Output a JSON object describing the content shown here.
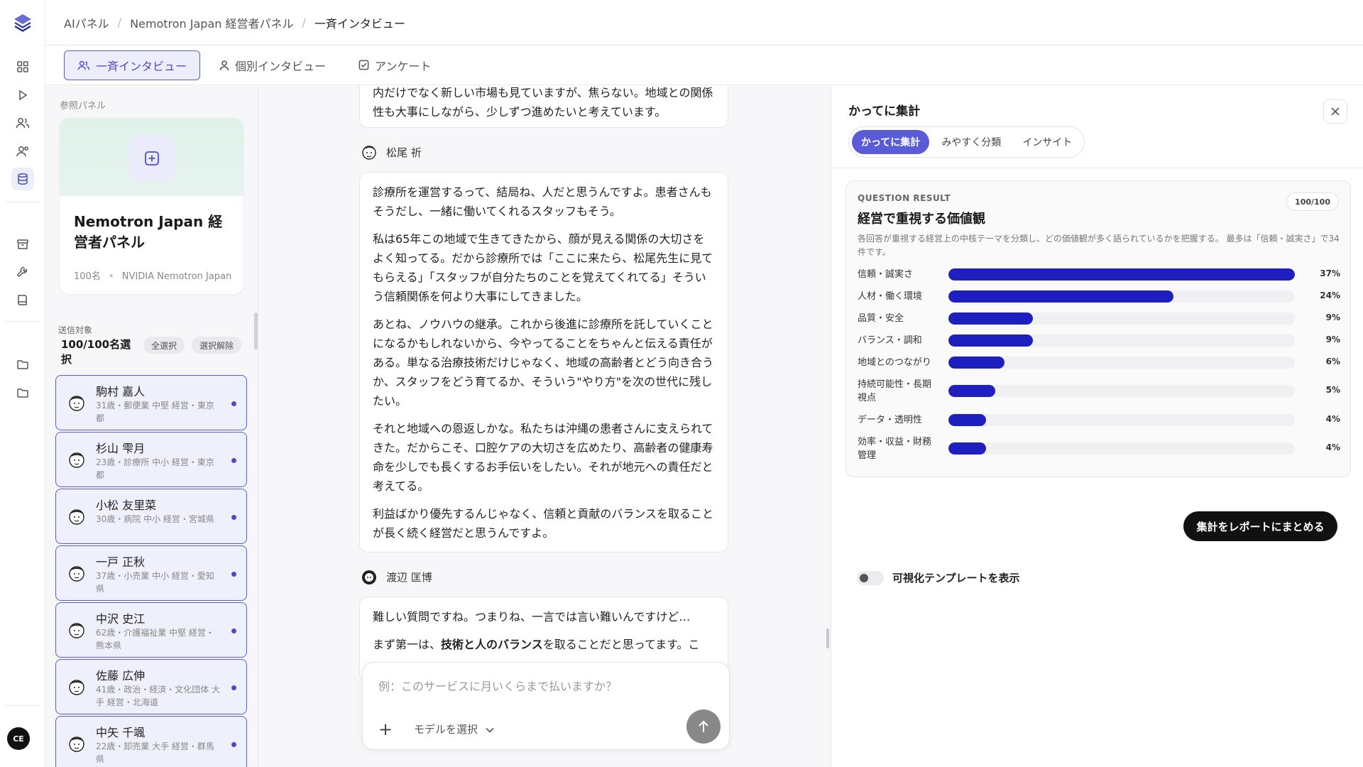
{
  "user": {
    "initials": "CE"
  },
  "breadcrumb": [
    "AIパネル",
    "Nemotron Japan 経営者パネル",
    "一斉インタビュー"
  ],
  "tabs": [
    {
      "label": "一斉インタビュー",
      "icon": "users-icon",
      "active": true
    },
    {
      "label": "個別インタビュー",
      "icon": "user-icon",
      "active": false
    },
    {
      "label": "アンケート",
      "icon": "checkbox-icon",
      "active": false
    }
  ],
  "left": {
    "ref_label": "参照パネル",
    "panel_name": "Nemotron Japan 経営者パネル",
    "panel_count": "100名",
    "panel_source": "NVIDIA Nemotron Japan",
    "send_label": "送信対象",
    "selected_count": "100/100名選択",
    "select_all": "全選択",
    "deselect": "選択解除",
    "people": [
      {
        "name": "駒村 嘉人",
        "meta": "31歳・郵便業 中堅 経営・東京都"
      },
      {
        "name": "杉山 雫月",
        "meta": "23歳・診療所 中小 経営・東京都"
      },
      {
        "name": "小松 友里菜",
        "meta": "30歳・病院 中小 経営・宮城県"
      },
      {
        "name": "一戸 正秋",
        "meta": "37歳・小売業 中小 経営・愛知県"
      },
      {
        "name": "中沢 史江",
        "meta": "62歳・介護福祉業 中堅 経営・熊本県"
      },
      {
        "name": "佐藤 広伸",
        "meta": "41歳・政治・経済・文化団体 大手 経営・北海道"
      },
      {
        "name": "中矢 千颯",
        "meta": "22歳・卸売業 大手 経営・群馬県"
      }
    ]
  },
  "chat": {
    "msg1": "内だけでなく新しい市場も見ていますが、焦らない。地域との関係性も大事にしながら、少しずつ進めたいと考えています。",
    "speaker2": "松尾 祈",
    "msg2": [
      "診療所を運営するって、結局ね、人だと思うんですよ。患者さんもそうだし、一緒に働いてくれるスタッフもそう。",
      "私は65年この地域で生きてきたから、顔が見える関係の大切さをよく知ってる。だから診療所では「ここに来たら、松尾先生に見てもらえる」「スタッフが自分たちのことを覚えてくれてる」そういう信頼関係を何より大事にしてきました。",
      "あとね、ノウハウの継承。これから後進に診療所を託していくことになるかもしれないから、今やってることをちゃんと伝える責任がある。単なる治療技術だけじゃなく、地域の高齢者とどう向き合うか、スタッフをどう育てるか、そういう\"やり方\"を次の世代に残したい。",
      "それと地域への恩返しかな。私たちは沖縄の患者さんに支えられてきた。だからこそ、口腔ケアの大切さを広めたり、高齢者の健康寿命を少しでも長くするお手伝いをしたい。それが地元への責任だと考えてる。",
      "利益ばかり優先するんじゃなく、信頼と貢献のバランスを取ることが長く続く経営だと思うんですよ。"
    ],
    "speaker3": "渡辺 匡博",
    "msg3a": "難しい質問ですね。つまりね、一言では言い難いんですけど…",
    "msg3b_pre": "まず第一は、",
    "msg3b_bold": "技術と人のバランス",
    "msg3b_post": "を取ることだと思ってます。こ",
    "input_placeholder": "例：このサービスに月いくらまで払いますか？",
    "model_label": "モデルを選択"
  },
  "right": {
    "title": "かってに集計",
    "segments": [
      {
        "label": "かってに集計",
        "active": true
      },
      {
        "label": "みやすく分類",
        "active": false
      },
      {
        "label": "インサイト",
        "active": false
      }
    ],
    "result": {
      "tag": "QUESTION RESULT",
      "badge": "100/100",
      "heading": "経営で重視する価値観",
      "desc": "各回答が重視する経営上の中核テーマを分類し、どの価値観が多く語られているかを把握する。 最多は「信頼・誠実さ」で34件です。"
    },
    "report_button": "集計をレポートにまとめる",
    "toggle_label": "可視化テンプレートを表示"
  },
  "chart_data": {
    "type": "bar",
    "orientation": "horizontal",
    "categories": [
      "信頼・誠実さ",
      "人材・働く環境",
      "品質・安全",
      "バランス・調和",
      "地域とのつながり",
      "持続可能性・長期視点",
      "データ・透明性",
      "効率・収益・財務管理"
    ],
    "values": [
      37,
      24,
      9,
      9,
      6,
      5,
      4,
      4
    ],
    "labels": [
      "37%",
      "24%",
      "9%",
      "9%",
      "6%",
      "5%",
      "4%",
      "4%"
    ],
    "xlim": [
      0,
      37
    ],
    "colors": {
      "bar": "#1f1fbf",
      "track": "#f0f0f3"
    }
  }
}
